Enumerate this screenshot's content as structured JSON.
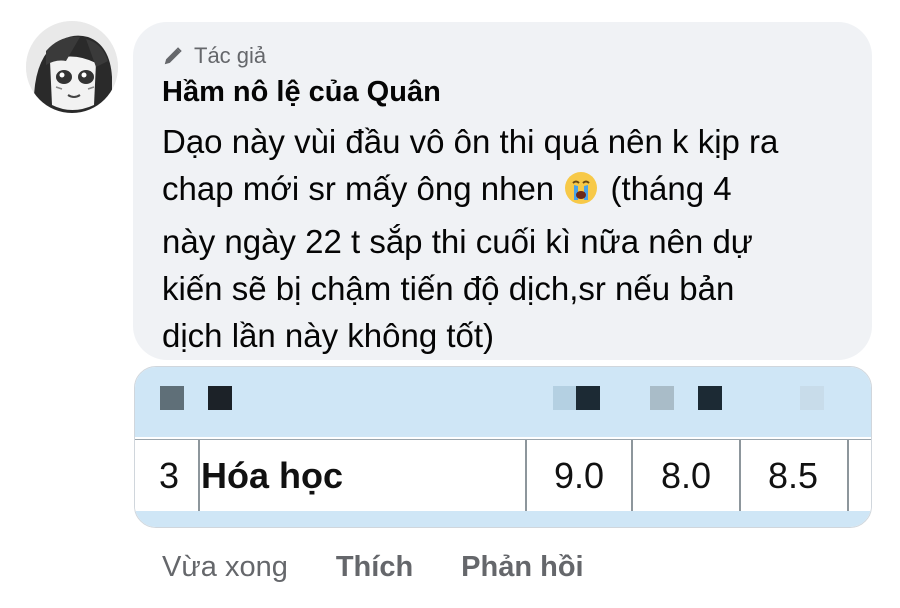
{
  "comment": {
    "badge_label": "Tác giả",
    "author": "Hầm nô lệ của Quân",
    "text_lines": [
      "Dạo này vùi đầu vô ôn thi quá nên k kịp ra",
      "chap mới sr mấy ông nhen",
      "(tháng 4",
      "này ngày 22 t sắp thi cuối kì nữa nên dự",
      "kiến sẽ bị chậm tiến độ dịch,sr nếu bản",
      "dịch lần này không tốt)"
    ],
    "emoji": "crying-face"
  },
  "attachment": {
    "row": {
      "index": "3",
      "subject": "Hóa học",
      "scores": [
        "9.0",
        "8.0",
        "8.5"
      ]
    },
    "colors": {
      "header": "#cfe6f6",
      "grid": "#8d969c"
    }
  },
  "actions": {
    "time": "Vừa xong",
    "like": "Thích",
    "reply": "Phản hồi"
  },
  "icons": {
    "badge": "pencil-icon",
    "avatar": "manga-avatar"
  }
}
